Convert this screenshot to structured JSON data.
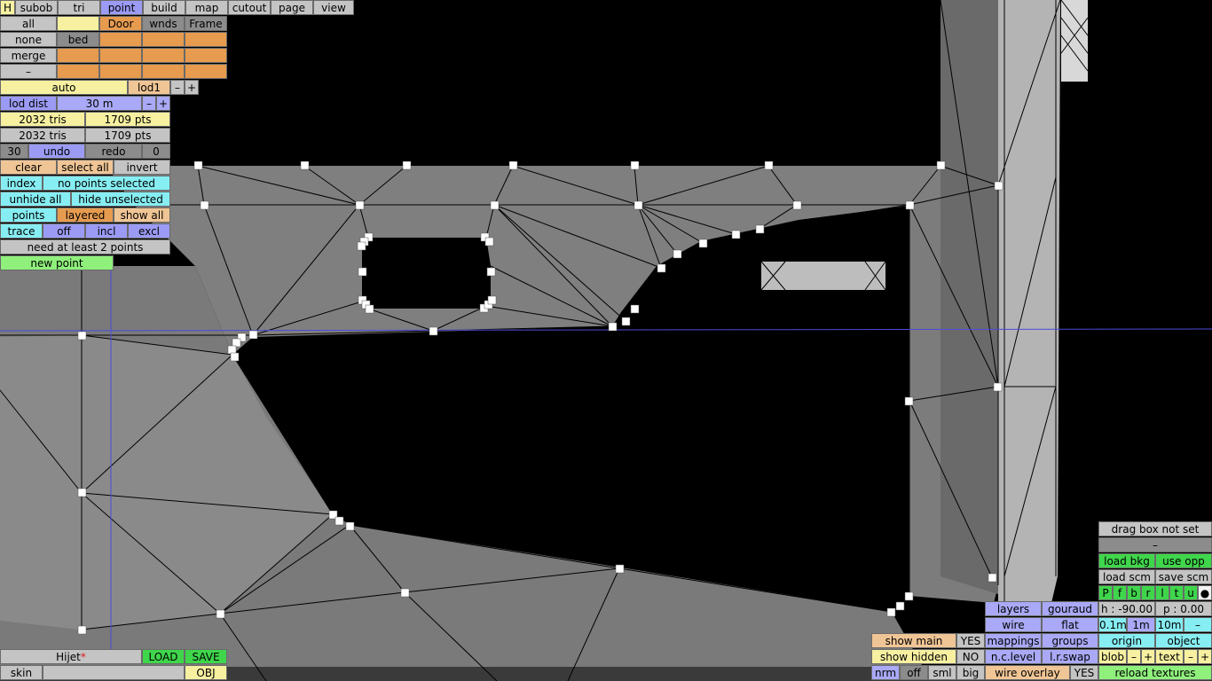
{
  "top_tabs": [
    "H",
    "subob",
    "tri",
    "point",
    "build",
    "map",
    "cutout",
    "page",
    "view"
  ],
  "subobject_panel": {
    "all": "all",
    "none": "none",
    "merge": "merge",
    "dash": "–",
    "slots": [
      "",
      "Door",
      "wnds",
      "Frame",
      "bed"
    ]
  },
  "lod": {
    "auto": "auto",
    "level": "lod1",
    "minus": "–",
    "plus": "+",
    "dist_label": "lod dist",
    "dist_value": "30 m"
  },
  "stats": {
    "tris_1": "2032 tris",
    "pts_1": "1709 pts",
    "tris_2": "2032 tris",
    "pts_2": "1709 pts"
  },
  "history": {
    "steps": "30",
    "undo": "undo",
    "redo": "redo",
    "redo_count": "0"
  },
  "selection": {
    "clear": "clear",
    "select_all": "select all",
    "invert": "invert",
    "index": "index",
    "status": "no points selected",
    "unhide_all": "unhide all",
    "hide_unselected": "hide unselected",
    "points": "points",
    "layered": "layered",
    "show_all": "show all",
    "trace": "trace",
    "off": "off",
    "incl": "incl",
    "excl": "excl",
    "hint": "need at least 2 points",
    "new_point": "new point"
  },
  "file": {
    "name": "Hijet",
    "modified": "*",
    "load": "LOAD",
    "save": "SAVE",
    "skin": "skin",
    "obj": "OBJ"
  },
  "display": {
    "show_main": "show main",
    "show_main_val": "YES",
    "show_hidden": "show hidden",
    "show_hidden_val": "NO",
    "nrm": "nrm",
    "off": "off",
    "sml": "sml",
    "big": "big",
    "layers": "layers",
    "gouraud": "gouraud",
    "wire": "wire",
    "flat": "flat",
    "mappings": "mappings",
    "groups": "groups",
    "nclevel": "n.c.level",
    "lrswap": "l.r.swap",
    "wire_overlay": "wire overlay",
    "wire_overlay_val": "YES"
  },
  "camera": {
    "drag_box": "drag box not set",
    "dash": "–",
    "load_bkg": "load bkg",
    "use_opp": "use opp",
    "load_scm": "load scm",
    "save_scm": "save scm",
    "flags": [
      "P",
      "f",
      "b",
      "r",
      "l",
      "t",
      "u",
      "●"
    ],
    "heading": "h : -90.00",
    "pitch": "p : 0.00",
    "step_small": "0.1m",
    "step_mid": "1m",
    "step_big": "10m",
    "step_minus": "–",
    "origin": "origin",
    "object": "object",
    "blob": "blob",
    "minus": "–",
    "plus": "+",
    "text": "text",
    "reload": "reload textures"
  },
  "colors": {
    "mesh": "#7e7e7e",
    "mesh_light": "#a9a9a9",
    "edges": "#000000",
    "vertex": "#ffffff",
    "guide_line": "#4b4bdc",
    "accent_orange": "#e69b4f"
  }
}
